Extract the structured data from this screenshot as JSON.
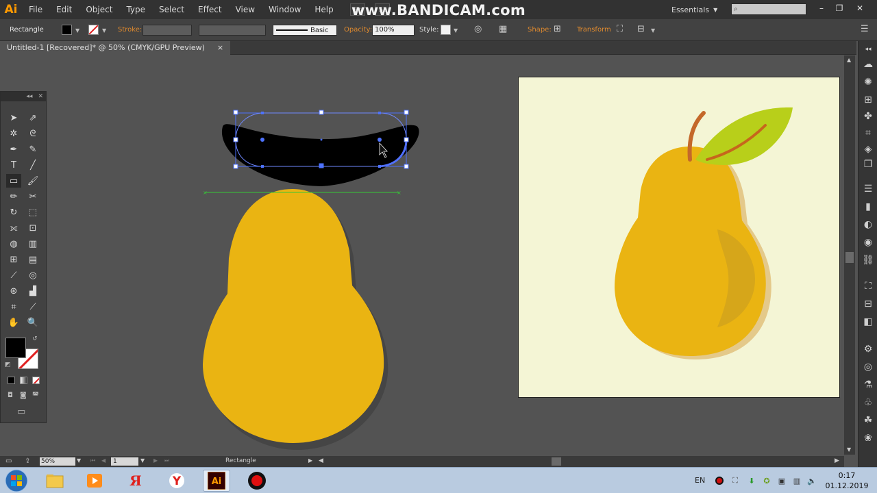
{
  "app": {
    "logo": "Ai",
    "menu": [
      "File",
      "Edit",
      "Object",
      "Type",
      "Select",
      "Effect",
      "View",
      "Window",
      "Help"
    ],
    "bridge_label": "Br",
    "stock_label": "St",
    "watermark": "www.BANDICAM.com",
    "workspace": "Essentials",
    "search_placeholder": ""
  },
  "control_bar": {
    "tool_name": "Rectangle",
    "stroke_label": "Stroke:",
    "brush_label": "Basic",
    "opacity_label": "Opacity:",
    "opacity_value": "100%",
    "style_label": "Style:",
    "shape_label": "Shape:",
    "transform_label": "Transform",
    "fill_color": "#000000",
    "stroke_color": "none"
  },
  "document": {
    "tab_title": "Untitled-1 [Recovered]* @ 50% (CMYK/GPU Preview)",
    "close_glyph": "×"
  },
  "status_bar": {
    "zoom": "50%",
    "artboard_number": "1",
    "current_tool": "Rectangle"
  },
  "colors": {
    "pear_body": "#eab412",
    "pear_shadow": "#e4c98a",
    "pear_highlight": "#d6a61a",
    "leaf": "#b8cf1a",
    "leaf_vein": "#c6661c",
    "stem": "#c4682a",
    "artboard_bg": "#f4f5d5",
    "selection": "#4d72ff",
    "accent_orange": "#e08a2e"
  },
  "taskbar": {
    "tray_language": "EN",
    "clock_time": "0:17",
    "clock_date": "01.12.2019"
  }
}
